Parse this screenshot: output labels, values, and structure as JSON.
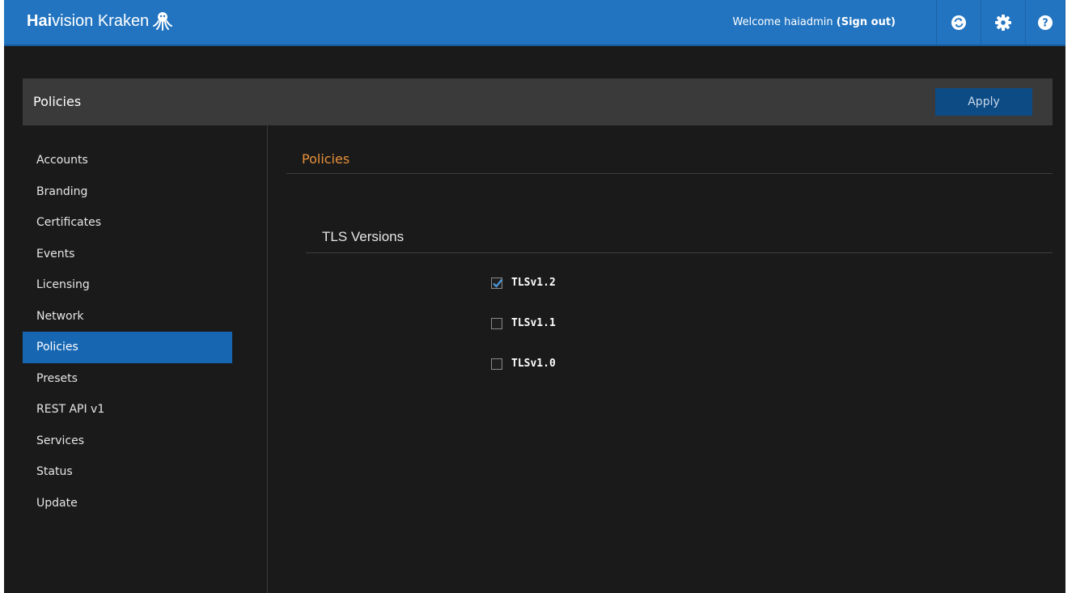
{
  "header": {
    "logo_bold": "Hai",
    "logo_rest": "vision Kraken",
    "welcome_prefix": "Welcome haiadmin",
    "sign_out": "(Sign out)",
    "icons": [
      "sync-icon",
      "gear-icon",
      "help-icon"
    ],
    "accent_color": "#2274c0"
  },
  "page": {
    "title": "Policies",
    "apply_label": "Apply"
  },
  "sidebar": {
    "items": [
      {
        "label": "Accounts"
      },
      {
        "label": "Branding"
      },
      {
        "label": "Certificates"
      },
      {
        "label": "Events"
      },
      {
        "label": "Licensing"
      },
      {
        "label": "Network"
      },
      {
        "label": "Policies",
        "active": true
      },
      {
        "label": "Presets"
      },
      {
        "label": "REST API v1"
      },
      {
        "label": "Services"
      },
      {
        "label": "Status"
      },
      {
        "label": "Update"
      }
    ]
  },
  "main": {
    "section_title": "Policies",
    "group_title": "TLS Versions",
    "options": [
      {
        "label": "TLSv1.2",
        "checked": true
      },
      {
        "label": "TLSv1.1",
        "checked": false
      },
      {
        "label": "TLSv1.0",
        "checked": false
      }
    ]
  }
}
